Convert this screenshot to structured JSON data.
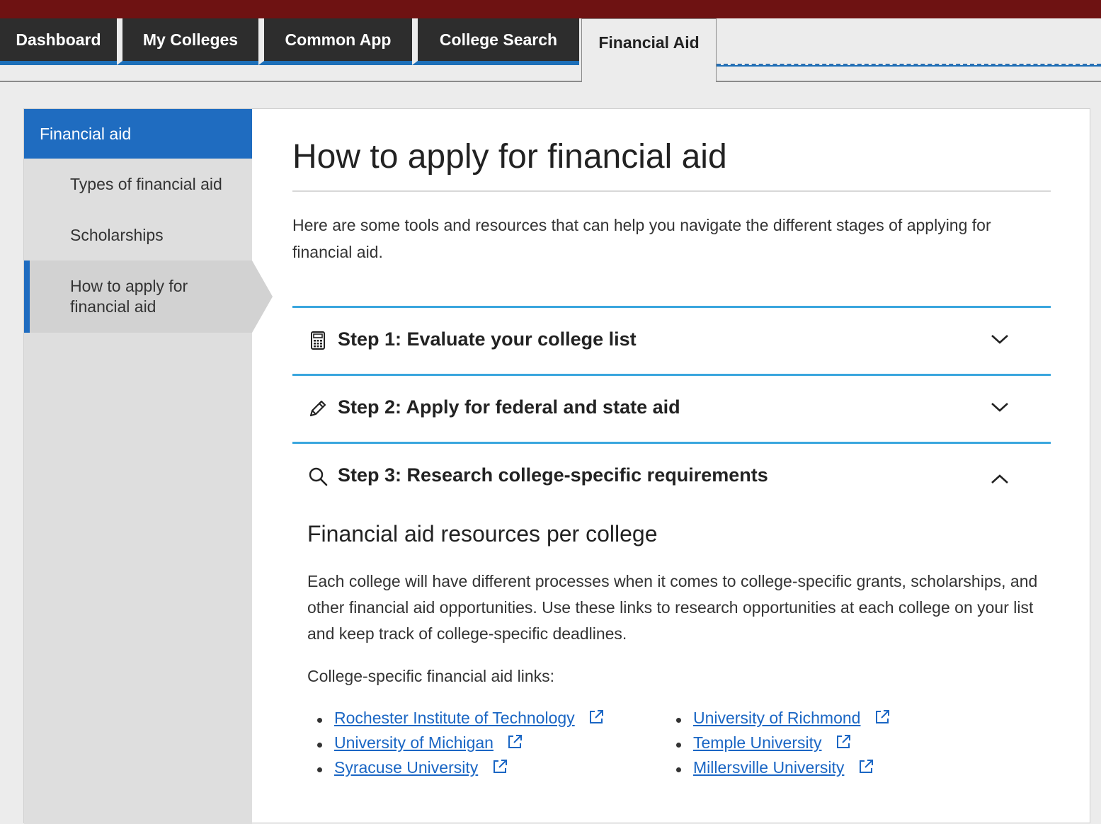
{
  "tabs": [
    {
      "label": "Dashboard"
    },
    {
      "label": "My Colleges"
    },
    {
      "label": "Common App"
    },
    {
      "label": "College Search"
    },
    {
      "label": "Financial Aid",
      "active": true
    }
  ],
  "sidebar": {
    "heading": "Financial aid",
    "items": [
      {
        "label": "Types of financial aid"
      },
      {
        "label": "Scholarships"
      },
      {
        "label": "How to apply for financial aid",
        "active": true
      }
    ]
  },
  "main": {
    "title": "How to apply for financial aid",
    "intro": "Here are some tools and resources that can help you navigate the different stages of applying for financial aid.",
    "steps": [
      {
        "label": "Step 1: Evaluate your college list",
        "icon": "calculator-icon",
        "expanded": false
      },
      {
        "label": "Step 2: Apply for federal and state aid",
        "icon": "pencil-icon",
        "expanded": false
      },
      {
        "label": "Step 3: Research college-specific requirements",
        "icon": "search-icon",
        "expanded": true
      }
    ],
    "step3": {
      "heading": "Financial aid resources per college",
      "paragraph": "Each college will have different processes when it comes to college-specific grants, scholarships, and other financial aid opportunities. Use these links to research opportunities at each college on your list and keep track of college-specific deadlines.",
      "links_label": "College-specific financial aid links:",
      "links_col1": [
        "Rochester Institute of Technology",
        "University of Michigan",
        "Syracuse University"
      ],
      "links_col2": [
        "University of Richmond",
        "Temple University",
        "Millersville University"
      ]
    }
  },
  "colors": {
    "topbar": "#6e1212",
    "accent_blue": "#1f6cc0",
    "step_rule": "#3aa6de",
    "link": "#1a66c4"
  }
}
